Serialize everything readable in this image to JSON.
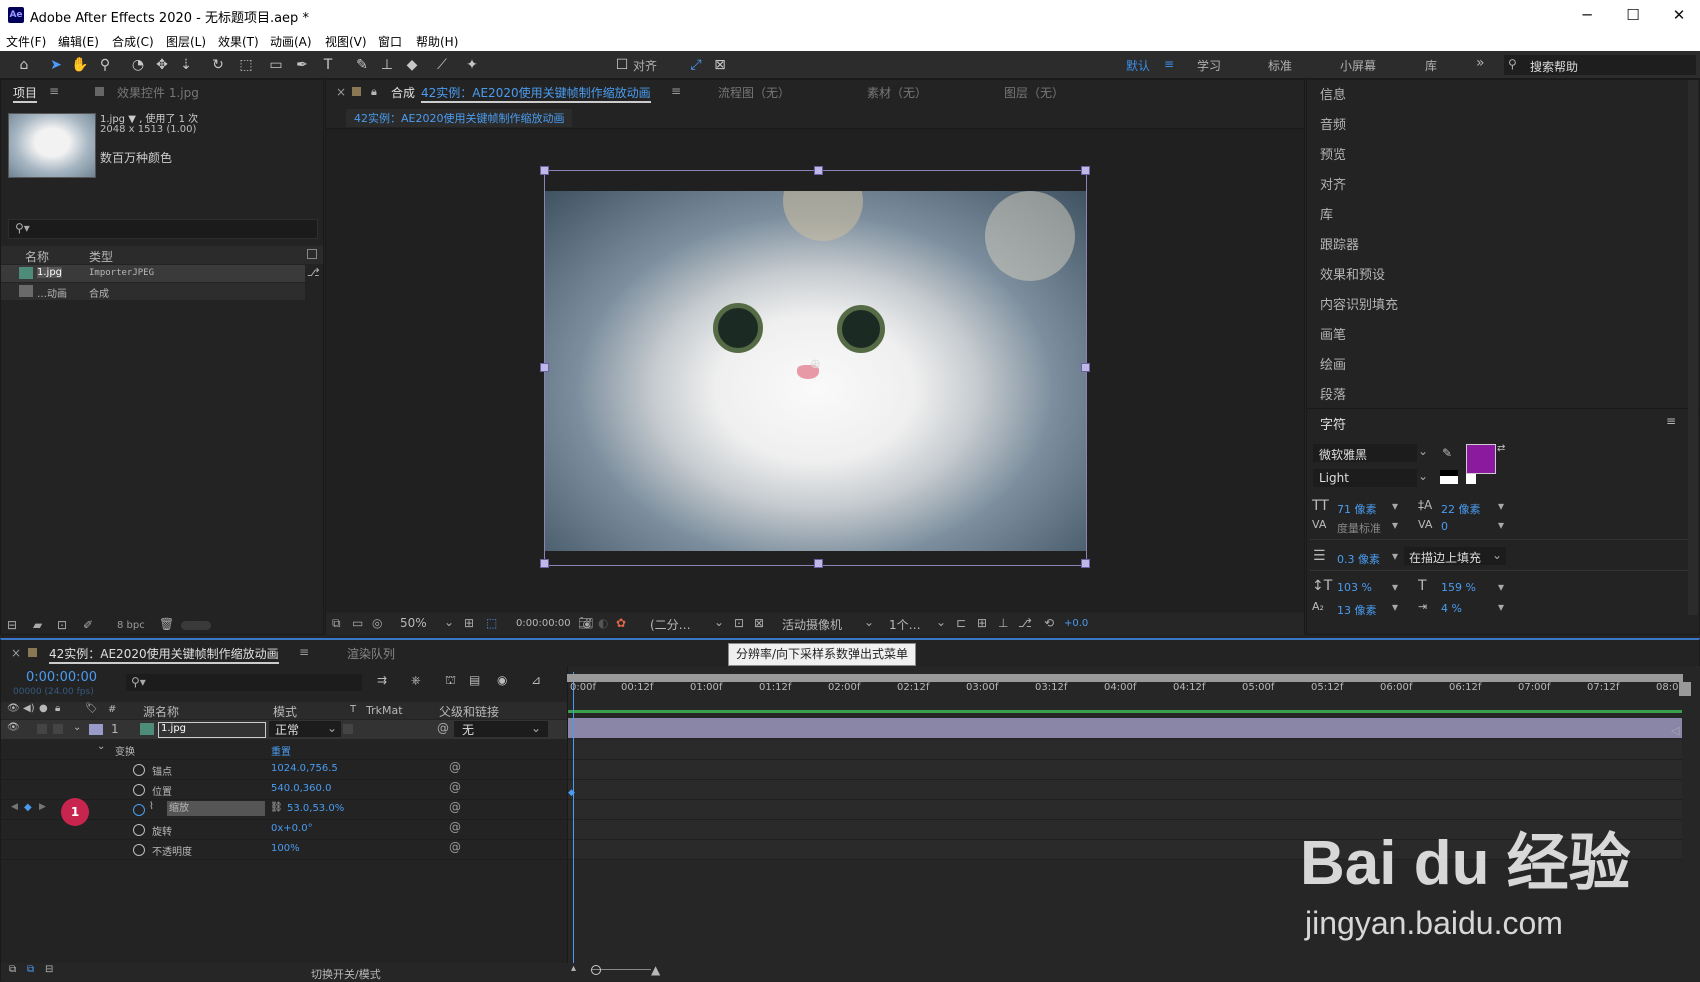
{
  "window": {
    "app_icon": "Ae",
    "title": "Adobe After Effects 2020 - 无标题项目.aep *",
    "min": "─",
    "max": "☐",
    "close": "✕"
  },
  "menu": [
    "文件(F)",
    "编辑(E)",
    "合成(C)",
    "图层(L)",
    "效果(T)",
    "动画(A)",
    "视图(V)",
    "窗口",
    "帮助(H)"
  ],
  "toolbar": {
    "align_label": "对齐",
    "workspaces": [
      "默认",
      "学习",
      "标准",
      "小屏幕",
      "库"
    ],
    "workspace_menu": "≡",
    "more": "»",
    "search_placeholder": "搜索帮助"
  },
  "project": {
    "tab_label": "项目",
    "tab_menu": "≡",
    "effects_tab": "效果控件 1.jpg",
    "file_name": "1.jpg ▼ , 使用了 1 次",
    "file_dims": "2048 x 1513 (1.00)",
    "file_colors": "数百万种颜色",
    "search_icon_text": "⚲▾",
    "col_name": "名称",
    "col_type": "类型",
    "items": [
      {
        "name": "1.jpg",
        "type": "ImporterJPEG"
      },
      {
        "name": "…动画",
        "type": "合成"
      }
    ],
    "bpc": "8 bpc"
  },
  "comp": {
    "close": "×",
    "tab_label": "合成",
    "tab_name": "42实例：AE2020使用关键帧制作缩放动画",
    "tab_menu": "≡",
    "flow_tab": "流程图（无）",
    "footage_tab": "素材（无）",
    "layer_tab": "图层（无）",
    "breadcrumb": "42实例：AE2020使用关键帧制作缩放动画",
    "zoom": "50%",
    "time": "0:00:00:00",
    "resolution": "(二分…",
    "camera": "活动摄像机",
    "views": "1个…",
    "exposure": "+0.0"
  },
  "right_panel": {
    "items": [
      "信息",
      "音频",
      "预览",
      "对齐",
      "库",
      "跟踪器",
      "效果和预设",
      "内容识别填充",
      "画笔",
      "绘画",
      "段落"
    ],
    "character_title": "字符",
    "char_menu": "≡",
    "font": "微软雅黑",
    "style": "Light",
    "font_size": "71 像素",
    "leading": "22 像素",
    "kerning": "度量标准",
    "tracking": "0",
    "stroke": "0.3 像素",
    "stroke_mode": "在描边上填充",
    "vscale": "103 %",
    "hscale": "159 %",
    "baseline": "13 像素",
    "tsume": "4 %",
    "fill_color": "#8b1a9e"
  },
  "timeline": {
    "close": "×",
    "comp_tab": "42实例：AE2020使用关键帧制作缩放动画",
    "tab_menu": "≡",
    "render_tab": "渲染队列",
    "timecode": "0:00:00:00",
    "timecode_sub": "00000 (24.00 fps)",
    "search_icon_text": "⚲▾",
    "col_num": "#",
    "col_source": "源名称",
    "col_mode": "模式",
    "col_t": "T",
    "col_trkmat": "TrkMat",
    "col_parent": "父级和链接",
    "layer_num": "1",
    "layer_name": "1.jpg",
    "layer_mode": "正常",
    "layer_parent": "无",
    "transform": "变换",
    "reset": "重置",
    "props": [
      {
        "name": "锚点",
        "value": "1024.0,756.5"
      },
      {
        "name": "位置",
        "value": "540.0,360.0"
      },
      {
        "name": "缩放",
        "value": "53.0,53.0%"
      },
      {
        "name": "旋转",
        "value": "0x+0.0°"
      },
      {
        "name": "不透明度",
        "value": "100%"
      }
    ],
    "annotation_badge": "1",
    "ruler_ticks": [
      "0:00f",
      "00:12f",
      "01:00f",
      "01:12f",
      "02:00f",
      "02:12f",
      "03:00f",
      "03:12f",
      "04:00f",
      "04:12f",
      "05:00f",
      "05:12f",
      "06:00f",
      "06:12f",
      "07:00f",
      "07:12f",
      "08:0"
    ],
    "footer_toggle": "切换开关/模式",
    "tooltip": "分辨率/向下采样系数弹出式菜单"
  },
  "watermark": {
    "brand": "Bai du 经验",
    "url": "jingyan.baidu.com"
  }
}
